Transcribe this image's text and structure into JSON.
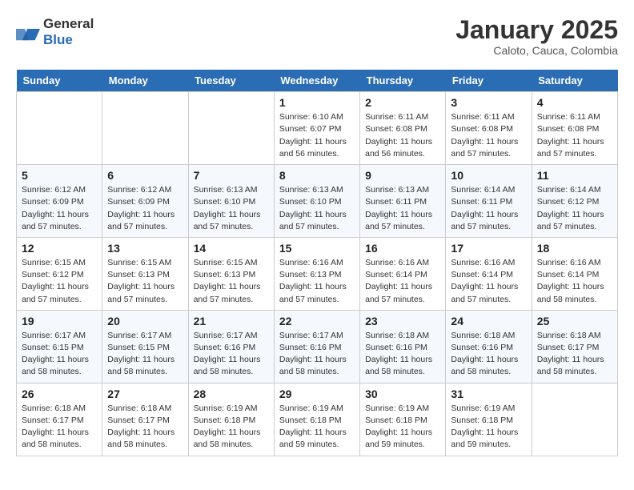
{
  "logo": {
    "general": "General",
    "blue": "Blue"
  },
  "header": {
    "month": "January 2025",
    "location": "Caloto, Cauca, Colombia"
  },
  "weekdays": [
    "Sunday",
    "Monday",
    "Tuesday",
    "Wednesday",
    "Thursday",
    "Friday",
    "Saturday"
  ],
  "weeks": [
    [
      {
        "date": "",
        "info": ""
      },
      {
        "date": "",
        "info": ""
      },
      {
        "date": "",
        "info": ""
      },
      {
        "date": "1",
        "info": "Sunrise: 6:10 AM\nSunset: 6:07 PM\nDaylight: 11 hours and 56 minutes."
      },
      {
        "date": "2",
        "info": "Sunrise: 6:11 AM\nSunset: 6:08 PM\nDaylight: 11 hours and 56 minutes."
      },
      {
        "date": "3",
        "info": "Sunrise: 6:11 AM\nSunset: 6:08 PM\nDaylight: 11 hours and 57 minutes."
      },
      {
        "date": "4",
        "info": "Sunrise: 6:11 AM\nSunset: 6:08 PM\nDaylight: 11 hours and 57 minutes."
      }
    ],
    [
      {
        "date": "5",
        "info": "Sunrise: 6:12 AM\nSunset: 6:09 PM\nDaylight: 11 hours and 57 minutes."
      },
      {
        "date": "6",
        "info": "Sunrise: 6:12 AM\nSunset: 6:09 PM\nDaylight: 11 hours and 57 minutes."
      },
      {
        "date": "7",
        "info": "Sunrise: 6:13 AM\nSunset: 6:10 PM\nDaylight: 11 hours and 57 minutes."
      },
      {
        "date": "8",
        "info": "Sunrise: 6:13 AM\nSunset: 6:10 PM\nDaylight: 11 hours and 57 minutes."
      },
      {
        "date": "9",
        "info": "Sunrise: 6:13 AM\nSunset: 6:11 PM\nDaylight: 11 hours and 57 minutes."
      },
      {
        "date": "10",
        "info": "Sunrise: 6:14 AM\nSunset: 6:11 PM\nDaylight: 11 hours and 57 minutes."
      },
      {
        "date": "11",
        "info": "Sunrise: 6:14 AM\nSunset: 6:12 PM\nDaylight: 11 hours and 57 minutes."
      }
    ],
    [
      {
        "date": "12",
        "info": "Sunrise: 6:15 AM\nSunset: 6:12 PM\nDaylight: 11 hours and 57 minutes."
      },
      {
        "date": "13",
        "info": "Sunrise: 6:15 AM\nSunset: 6:13 PM\nDaylight: 11 hours and 57 minutes."
      },
      {
        "date": "14",
        "info": "Sunrise: 6:15 AM\nSunset: 6:13 PM\nDaylight: 11 hours and 57 minutes."
      },
      {
        "date": "15",
        "info": "Sunrise: 6:16 AM\nSunset: 6:13 PM\nDaylight: 11 hours and 57 minutes."
      },
      {
        "date": "16",
        "info": "Sunrise: 6:16 AM\nSunset: 6:14 PM\nDaylight: 11 hours and 57 minutes."
      },
      {
        "date": "17",
        "info": "Sunrise: 6:16 AM\nSunset: 6:14 PM\nDaylight: 11 hours and 57 minutes."
      },
      {
        "date": "18",
        "info": "Sunrise: 6:16 AM\nSunset: 6:14 PM\nDaylight: 11 hours and 58 minutes."
      }
    ],
    [
      {
        "date": "19",
        "info": "Sunrise: 6:17 AM\nSunset: 6:15 PM\nDaylight: 11 hours and 58 minutes."
      },
      {
        "date": "20",
        "info": "Sunrise: 6:17 AM\nSunset: 6:15 PM\nDaylight: 11 hours and 58 minutes."
      },
      {
        "date": "21",
        "info": "Sunrise: 6:17 AM\nSunset: 6:16 PM\nDaylight: 11 hours and 58 minutes."
      },
      {
        "date": "22",
        "info": "Sunrise: 6:17 AM\nSunset: 6:16 PM\nDaylight: 11 hours and 58 minutes."
      },
      {
        "date": "23",
        "info": "Sunrise: 6:18 AM\nSunset: 6:16 PM\nDaylight: 11 hours and 58 minutes."
      },
      {
        "date": "24",
        "info": "Sunrise: 6:18 AM\nSunset: 6:16 PM\nDaylight: 11 hours and 58 minutes."
      },
      {
        "date": "25",
        "info": "Sunrise: 6:18 AM\nSunset: 6:17 PM\nDaylight: 11 hours and 58 minutes."
      }
    ],
    [
      {
        "date": "26",
        "info": "Sunrise: 6:18 AM\nSunset: 6:17 PM\nDaylight: 11 hours and 58 minutes."
      },
      {
        "date": "27",
        "info": "Sunrise: 6:18 AM\nSunset: 6:17 PM\nDaylight: 11 hours and 58 minutes."
      },
      {
        "date": "28",
        "info": "Sunrise: 6:19 AM\nSunset: 6:18 PM\nDaylight: 11 hours and 58 minutes."
      },
      {
        "date": "29",
        "info": "Sunrise: 6:19 AM\nSunset: 6:18 PM\nDaylight: 11 hours and 59 minutes."
      },
      {
        "date": "30",
        "info": "Sunrise: 6:19 AM\nSunset: 6:18 PM\nDaylight: 11 hours and 59 minutes."
      },
      {
        "date": "31",
        "info": "Sunrise: 6:19 AM\nSunset: 6:18 PM\nDaylight: 11 hours and 59 minutes."
      },
      {
        "date": "",
        "info": ""
      }
    ]
  ]
}
